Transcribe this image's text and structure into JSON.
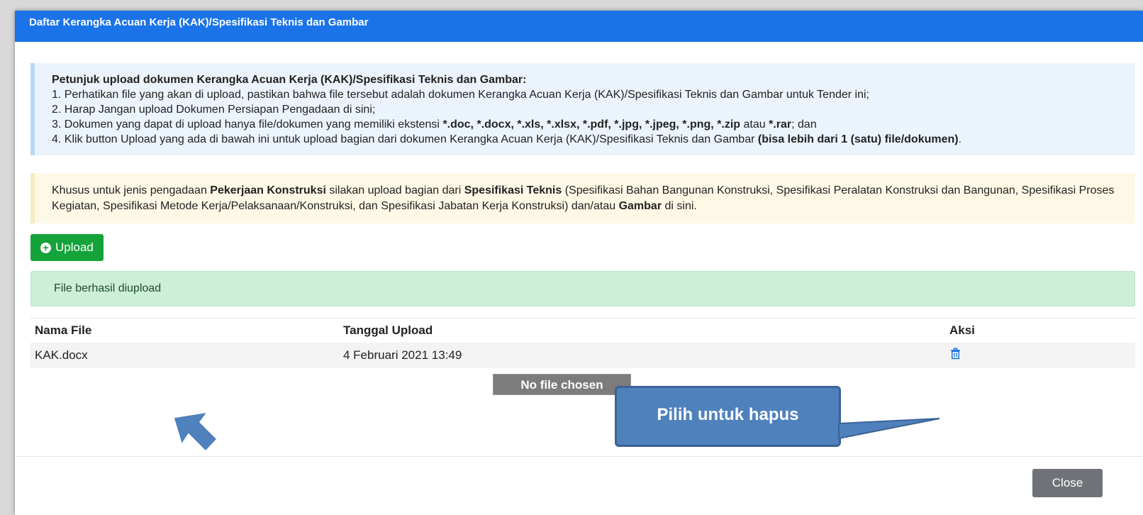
{
  "modal": {
    "title": "Daftar Kerangka Acuan Kerja (KAK)/Spesifikasi Teknis dan Gambar"
  },
  "instructions": {
    "title": "Petunjuk upload dokumen Kerangka Acuan Kerja (KAK)/Spesifikasi Teknis dan Gambar:",
    "item1": "1. Perhatikan file yang akan di upload, pastikan bahwa file tersebut adalah dokumen Kerangka Acuan Kerja (KAK)/Spesifikasi Teknis dan Gambar untuk Tender ini;",
    "item2": "2. Harap Jangan upload Dokumen Persiapan Pengadaan di sini;",
    "item3_prefix": "3. Dokumen yang dapat di upload hanya file/dokumen yang memiliki ekstensi ",
    "item3_ext": "*.doc, *.docx, *.xls, *.xlsx, *.pdf, *.jpg, *.jpeg, *.png, *.zip",
    "item3_mid": " atau ",
    "item3_rar": "*.rar",
    "item3_suffix": "; dan",
    "item4_prefix": "4. Klik button Upload yang ada di bawah ini untuk upload bagian dari dokumen Kerangka Acuan Kerja (KAK)/Spesifikasi Teknis dan Gambar ",
    "item4_bold": "(bisa lebih dari 1 (satu) file/dokumen)",
    "item4_suffix": "."
  },
  "notice": {
    "part1": "Khusus untuk jenis pengadaan ",
    "bold1": "Pekerjaan Konstruksi",
    "part2": " silakan upload bagian dari ",
    "bold2": "Spesifikasi Teknis",
    "part3": " (Spesifikasi Bahan Bangunan Konstruksi, Spesifikasi Peralatan Konstruksi dan Bangunan, Spesifikasi Proses Kegiatan, Spesifikasi Metode Kerja/Pelaksanaan/Konstruksi, dan Spesifikasi Jabatan Kerja Konstruksi) dan/atau ",
    "bold3": "Gambar",
    "part4": " di sini."
  },
  "upload_button": {
    "label": "Upload",
    "icon": "plus-circle-icon"
  },
  "success_message": "File berhasil diupload",
  "table": {
    "headers": {
      "name": "Nama File",
      "date": "Tanggal Upload",
      "action": "Aksi"
    },
    "rows": [
      {
        "name": "KAK.docx",
        "date": "4 Februari 2021 13:49",
        "action_icon": "trash-icon"
      }
    ]
  },
  "file_input_tooltip": "No file chosen",
  "annotation": {
    "callout": "Pilih untuk hapus"
  },
  "close_button": "Close",
  "colors": {
    "header": "#1a73e8",
    "upload": "#14a33a",
    "success_bg": "#cdeed7",
    "callout": "#4f81bd",
    "close": "#6f7378"
  }
}
